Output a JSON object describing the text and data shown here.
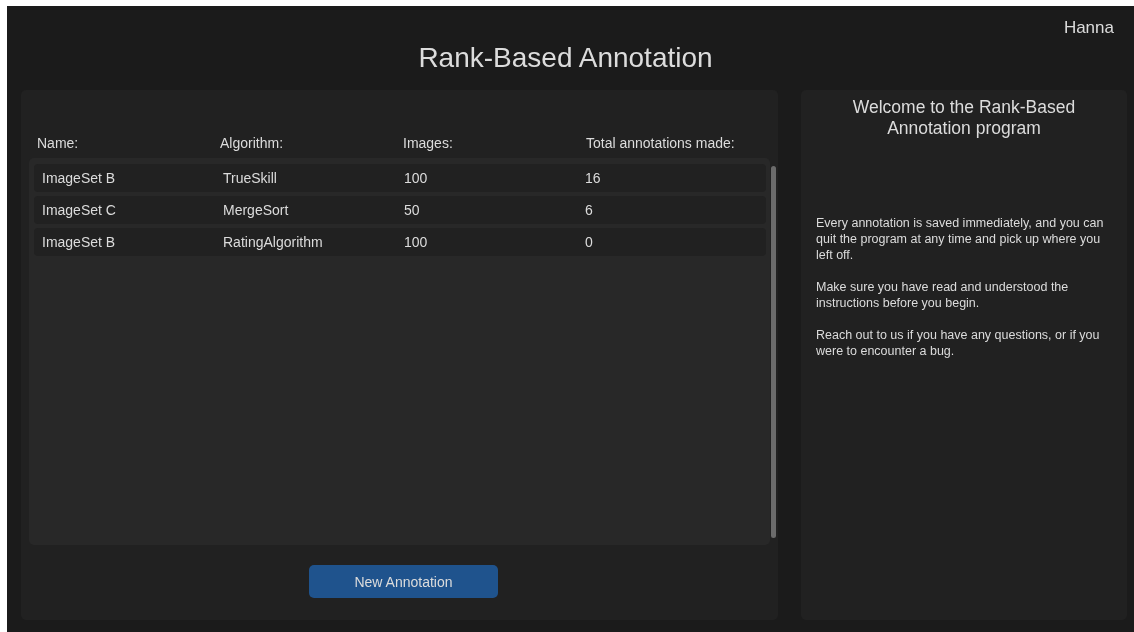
{
  "user": "Hanna",
  "title": "Rank-Based Annotation",
  "table": {
    "columns": [
      "Name:",
      "Algorithm:",
      "Images:",
      "Total annotations made:"
    ],
    "rows": [
      {
        "cells": [
          "ImageSet B",
          "TrueSkill",
          "100",
          "16"
        ]
      },
      {
        "cells": [
          "ImageSet C",
          "MergeSort",
          "50",
          "6"
        ]
      },
      {
        "cells": [
          "ImageSet B",
          "RatingAlgorithm",
          "100",
          "0"
        ]
      }
    ]
  },
  "new_button": "New Annotation",
  "welcome": {
    "title": "Welcome to the Rank-Based Annotation program",
    "paragraphs": [
      "Every annotation is saved immediately, and you can quit the program at any time and pick up where you left off.",
      "Make sure you have read and understood the instructions before you begin.",
      "Reach out to us if you have any questions, or if you were to encounter a bug."
    ]
  }
}
